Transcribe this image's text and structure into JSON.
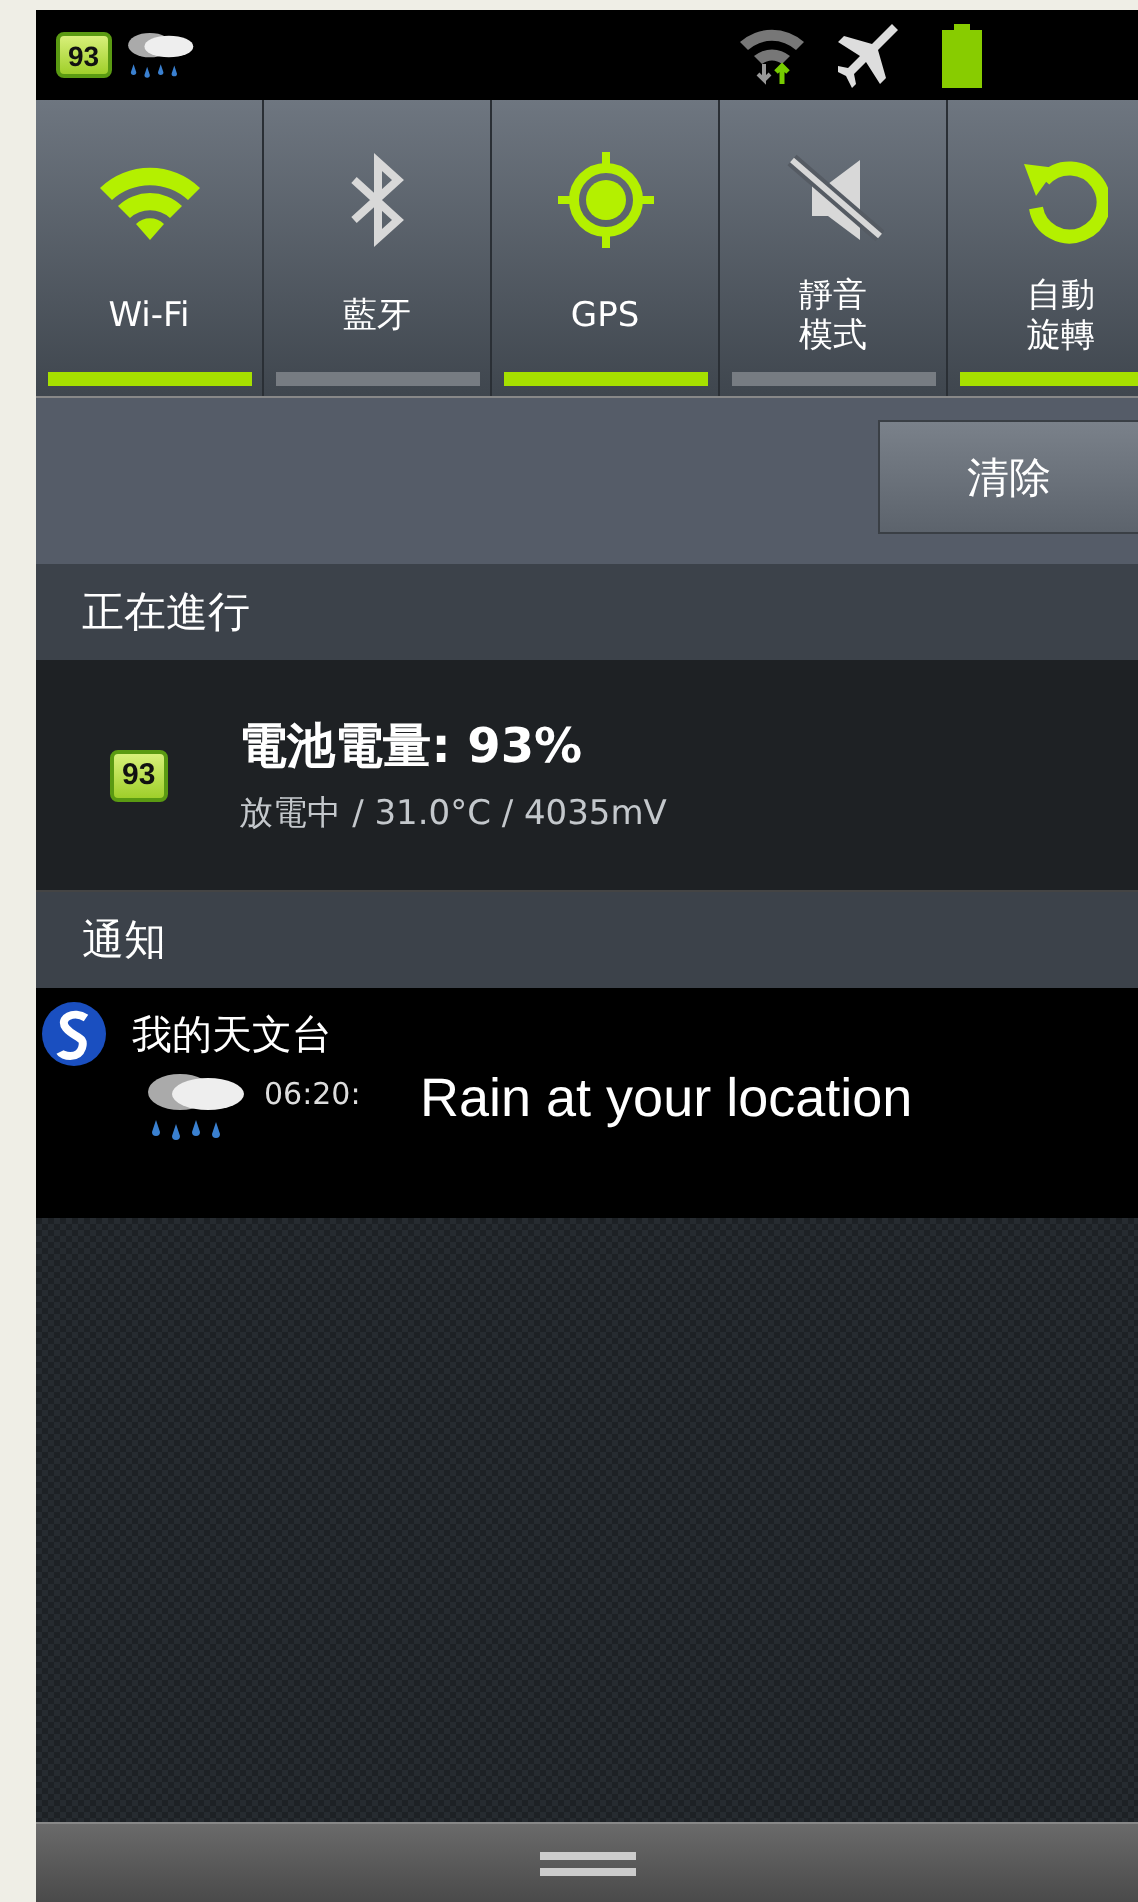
{
  "status_bar": {
    "battery_badge": "93"
  },
  "toggles": [
    {
      "kind": "wifi",
      "label": "Wi-Fi",
      "on": true
    },
    {
      "kind": "bluetooth",
      "label": "藍牙",
      "on": false
    },
    {
      "kind": "gps",
      "label": "GPS",
      "on": true
    },
    {
      "kind": "mute",
      "label": "靜音模式",
      "on": false
    },
    {
      "kind": "rotate",
      "label": "自動旋轉",
      "on": true
    }
  ],
  "clear_button": "清除",
  "ongoing": {
    "header": "正在進行",
    "battery_badge": "93",
    "title": "電池電量: 93%",
    "subtitle": "放電中 / 31.0°C / 4035mV"
  },
  "notifications": {
    "header": "通知",
    "items": [
      {
        "app": "我的天文台",
        "time": "06:20:",
        "message": "Rain at your location"
      }
    ]
  }
}
